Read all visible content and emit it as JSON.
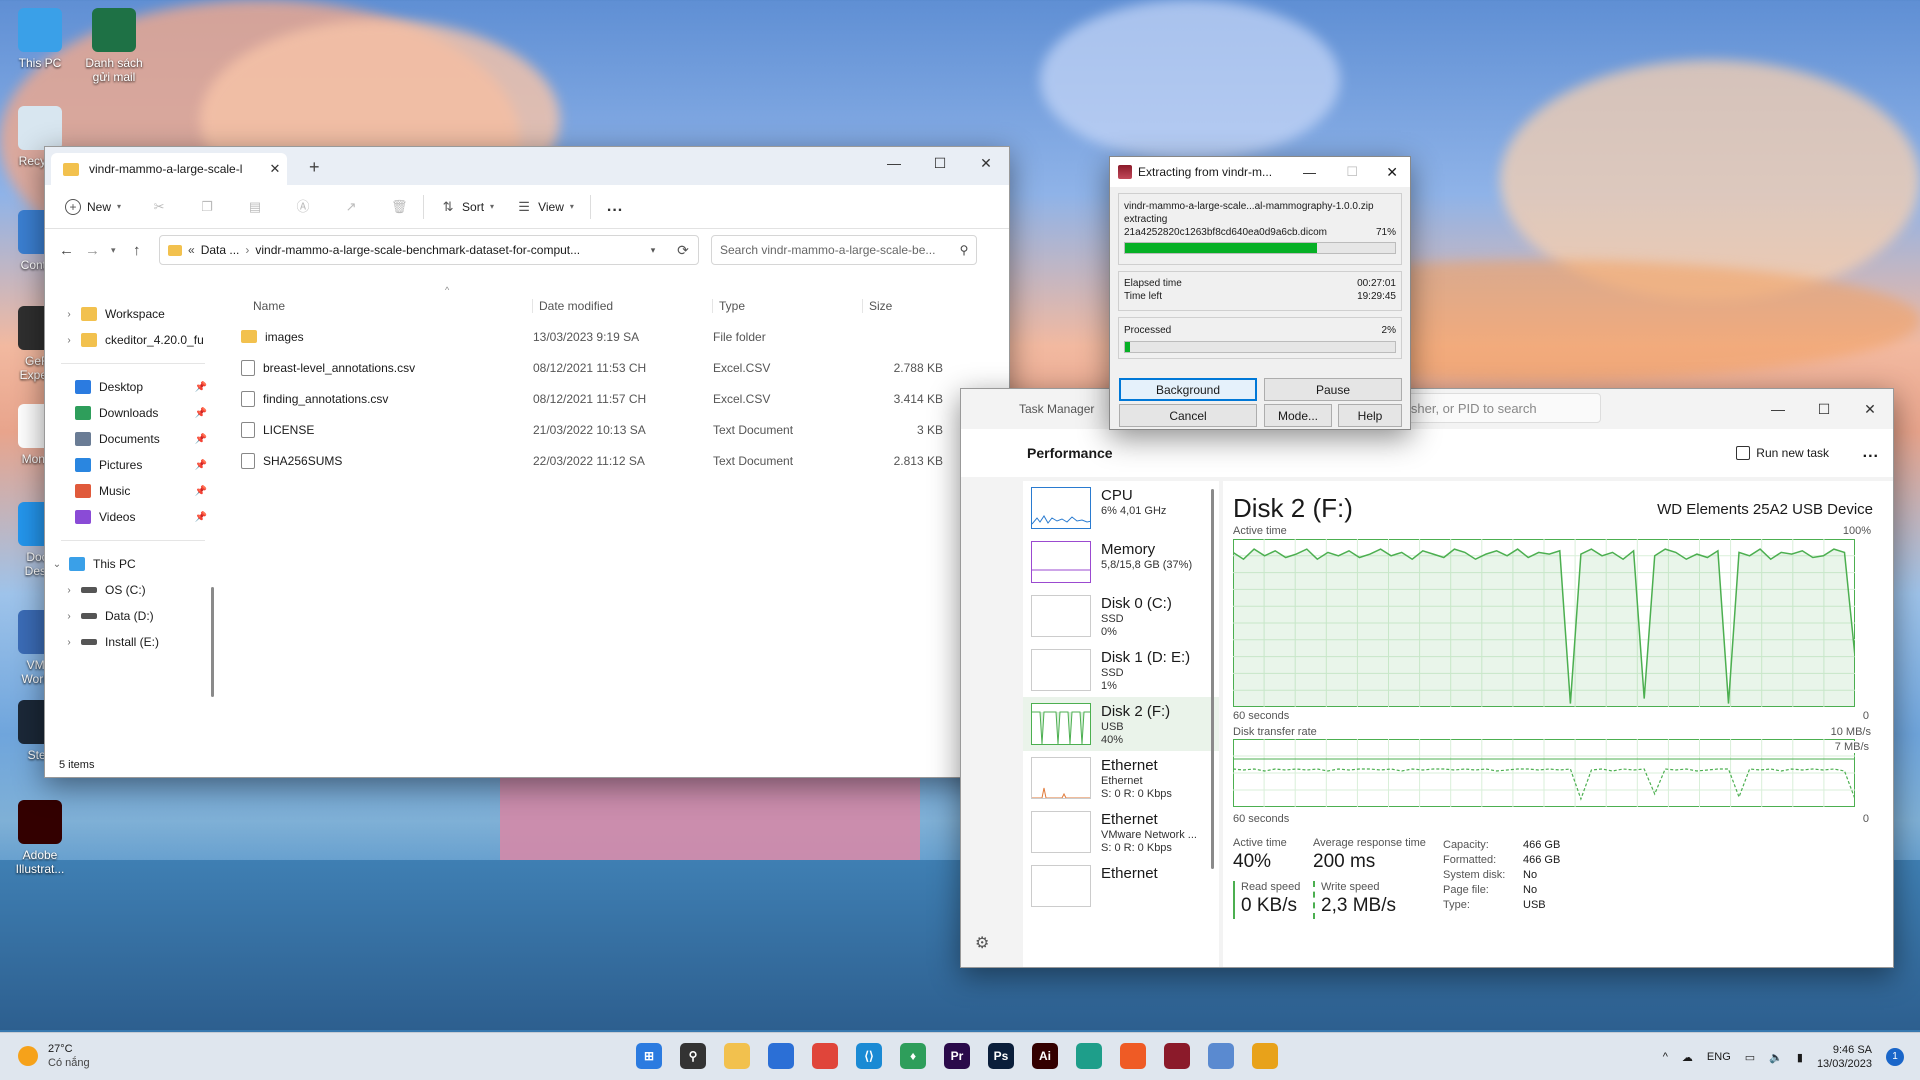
{
  "desktop": {
    "icons": [
      {
        "label": "This PC",
        "color": "#3aa0e8"
      },
      {
        "label": "Danh sách gửi mail",
        "color": "#1e7145"
      },
      {
        "label": "Recycle Bin",
        "color": "#d8e6f0"
      },
      {
        "label": "Control Panel",
        "color": "#3b7fd1"
      },
      {
        "label": "GeForce Experience",
        "color": "#2f2f2f"
      },
      {
        "label": "MongoDB",
        "color": "#ffffff"
      },
      {
        "label": "Docker Desktop",
        "color": "#2496ed"
      },
      {
        "label": "VMware Workstation",
        "color": "#3b6cb7"
      },
      {
        "label": "Steam",
        "color": "#1b2838"
      },
      {
        "label": "Adobe Illustrator",
        "color": "#330000"
      }
    ],
    "icon_visible_labels": [
      "This PC",
      "Danh sách\ngửi mail",
      "Recycle",
      "Control",
      "GeFo\nExperie",
      "Mongo",
      "Dock\nDeskt",
      "VMw\nWorkst",
      "Stea",
      "Adobe\nIllustrat..."
    ]
  },
  "explorer": {
    "tab_title": "vindr-mammo-a-large-scale-l",
    "toolbar": {
      "new_label": "New",
      "sort_label": "Sort",
      "view_label": "View",
      "more_label": "..."
    },
    "address": {
      "prefix": "«",
      "crumb1": "Data ...",
      "crumb2": "vindr-mammo-a-large-scale-benchmark-dataset-for-comput..."
    },
    "search_placeholder": "Search vindr-mammo-a-large-scale-be...",
    "nav": {
      "quick": [
        {
          "label": "Workspace",
          "color": "#f2c14e"
        },
        {
          "label": "ckeditor_4.20.0_fu",
          "color": "#f2c14e"
        }
      ],
      "pinned": [
        {
          "label": "Desktop",
          "color": "#2b7be0"
        },
        {
          "label": "Downloads",
          "color": "#2e9e5b"
        },
        {
          "label": "Documents",
          "color": "#6a7c95"
        },
        {
          "label": "Pictures",
          "color": "#2a86e0"
        },
        {
          "label": "Music",
          "color": "#e05a3b"
        },
        {
          "label": "Videos",
          "color": "#8a4bd6"
        }
      ],
      "thispc": "This PC",
      "drives": [
        {
          "label": "OS (C:)"
        },
        {
          "label": "Data (D:)"
        },
        {
          "label": "Install (E:)"
        }
      ]
    },
    "columns": {
      "name": "Name",
      "date": "Date modified",
      "type": "Type",
      "size": "Size"
    },
    "files": [
      {
        "name": "images",
        "date": "13/03/2023 9:19 SA",
        "type": "File folder",
        "size": "",
        "folder": true
      },
      {
        "name": "breast-level_annotations.csv",
        "date": "08/12/2021 11:53 CH",
        "type": "Excel.CSV",
        "size": "2.788 KB",
        "folder": false
      },
      {
        "name": "finding_annotations.csv",
        "date": "08/12/2021 11:57 CH",
        "type": "Excel.CSV",
        "size": "3.414 KB",
        "folder": false
      },
      {
        "name": "LICENSE",
        "date": "21/03/2022 10:13 SA",
        "type": "Text Document",
        "size": "3 KB",
        "folder": false
      },
      {
        "name": "SHA256SUMS",
        "date": "22/03/2022 11:12 SA",
        "type": "Text Document",
        "size": "2.813 KB",
        "folder": false
      }
    ],
    "status": "5 items"
  },
  "winrar": {
    "title": "Extracting from vindr-m...",
    "archive": "vindr-mammo-a-large-scale...al-mammography-1.0.0.zip",
    "action": "extracting",
    "file": "21a4252820c1263bf8cd640ea0d9a6cb.dicom",
    "file_pct": "71%",
    "file_progress": 0.71,
    "elapsed_label": "Elapsed time",
    "elapsed": "00:27:01",
    "left_label": "Time left",
    "left": "19:29:45",
    "processed_label": "Processed",
    "processed_pct": "2%",
    "processed_progress": 0.02,
    "buttons": {
      "background": "Background",
      "pause": "Pause",
      "cancel": "Cancel",
      "mode": "Mode...",
      "help": "Help"
    }
  },
  "taskmgr": {
    "title": "Task Manager",
    "search_placeholder": "isher, or PID to search",
    "section": "Performance",
    "run_new_task": "Run new task",
    "more": "...",
    "side": [
      {
        "name": "CPU",
        "sub1": "6% 4,01 GHz",
        "sub2": "",
        "sub3": ""
      },
      {
        "name": "Memory",
        "sub1": "5,8/15,8 GB (37%)",
        "sub2": "",
        "sub3": ""
      },
      {
        "name": "Disk 0 (C:)",
        "sub1": "SSD",
        "sub2": "0%",
        "sub3": ""
      },
      {
        "name": "Disk 1 (D: E:)",
        "sub1": "SSD",
        "sub2": "1%",
        "sub3": ""
      },
      {
        "name": "Disk 2 (F:)",
        "sub1": "USB",
        "sub2": "40%",
        "sub3": ""
      },
      {
        "name": "Ethernet",
        "sub1": "Ethernet",
        "sub2": "S: 0 R: 0 Kbps",
        "sub3": ""
      },
      {
        "name": "Ethernet",
        "sub1": "VMware Network ...",
        "sub2": "S: 0 R: 0 Kbps",
        "sub3": ""
      },
      {
        "name": "Ethernet",
        "sub1": "",
        "sub2": "",
        "sub3": ""
      }
    ],
    "disk_title": "Disk 2 (F:)",
    "device": "WD Elements 25A2 USB Device",
    "active_label": "Active time",
    "pct100": "100%",
    "sixty1": "60 seconds",
    "zero1": "0",
    "transfer_label": "Disk transfer rate",
    "mbs10": "10 MB/s",
    "mbs7": "7 MB/s",
    "sixty2": "60 seconds",
    "zero2": "0",
    "stats": {
      "active_time_label": "Active time",
      "active_time": "40%",
      "resp_label": "Average response time",
      "resp": "200 ms",
      "read_label": "Read speed",
      "read": "0 KB/s",
      "write_label": "Write speed",
      "write": "2,3 MB/s"
    },
    "props": [
      {
        "k": "Capacity:",
        "v": "466 GB"
      },
      {
        "k": "Formatted:",
        "v": "466 GB"
      },
      {
        "k": "System disk:",
        "v": "No"
      },
      {
        "k": "Page file:",
        "v": "No"
      },
      {
        "k": "Type:",
        "v": "USB"
      }
    ]
  },
  "taskbar": {
    "weather_temp": "27°C",
    "weather_desc": "Có nắng",
    "lang": "ENG",
    "time": "9:46 SA",
    "date": "13/03/2023",
    "notif": "1",
    "apps": [
      {
        "name": "start-icon",
        "color": "#2b7be0",
        "glyph": "⊞"
      },
      {
        "name": "search-icon",
        "color": "#333333",
        "glyph": "⚲"
      },
      {
        "name": "file-explorer-icon",
        "color": "#f2c14e",
        "glyph": ""
      },
      {
        "name": "store-icon",
        "color": "#2b6fd6",
        "glyph": ""
      },
      {
        "name": "chrome-icon",
        "color": "#e0453a",
        "glyph": ""
      },
      {
        "name": "vscode-icon",
        "color": "#1a8ad4",
        "glyph": "⟨⟩"
      },
      {
        "name": "mongodb-icon",
        "color": "#2e9e5b",
        "glyph": "♦"
      },
      {
        "name": "premiere-icon",
        "color": "#2a0a4a",
        "glyph": "Pr"
      },
      {
        "name": "photoshop-icon",
        "color": "#0a1e3a",
        "glyph": "Ps"
      },
      {
        "name": "illustrator-icon",
        "color": "#330000",
        "glyph": "Ai"
      },
      {
        "name": "edge-dev-icon",
        "color": "#1e9e8a",
        "glyph": ""
      },
      {
        "name": "postman-icon",
        "color": "#ef5b25",
        "glyph": ""
      },
      {
        "name": "winrar-icon",
        "color": "#8b1a2a",
        "glyph": ""
      },
      {
        "name": "task-manager-icon",
        "color": "#5a8ad0",
        "glyph": ""
      },
      {
        "name": "chrome-canary-icon",
        "color": "#e8a21a",
        "glyph": ""
      }
    ]
  }
}
